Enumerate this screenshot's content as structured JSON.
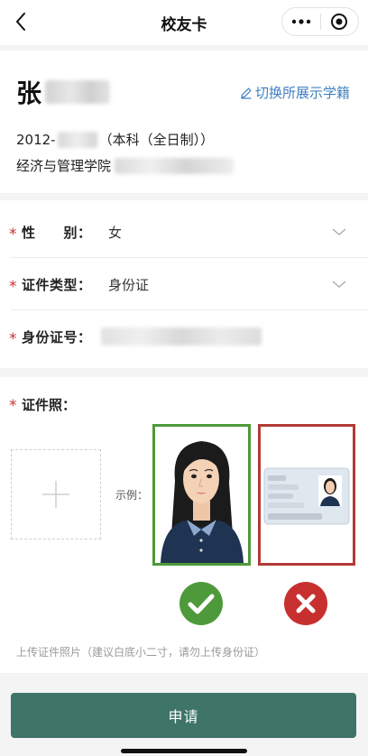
{
  "nav": {
    "title": "校友卡"
  },
  "profile": {
    "name_visible": "张",
    "switch_label": "切换所展示学籍",
    "enroll_year": "2012-",
    "degree": "（本科（全日制））",
    "college": "经济与管理学院"
  },
  "form": {
    "gender_label": "性　　别：",
    "gender_value": "女",
    "id_type_label": "证件类型：",
    "id_type_value": "身份证",
    "id_number_label": "身份证号："
  },
  "photo": {
    "label": "证件照：",
    "example_label": "示例：",
    "hint": "上传证件照片（建议白底小二寸，请勿上传身份证）"
  },
  "submit": {
    "label": "申请"
  },
  "colors": {
    "accent": "#3f7fc0",
    "button": "#3f7468",
    "required": "#c8302f",
    "good": "#4e9a3a",
    "bad": "#b23a36"
  }
}
